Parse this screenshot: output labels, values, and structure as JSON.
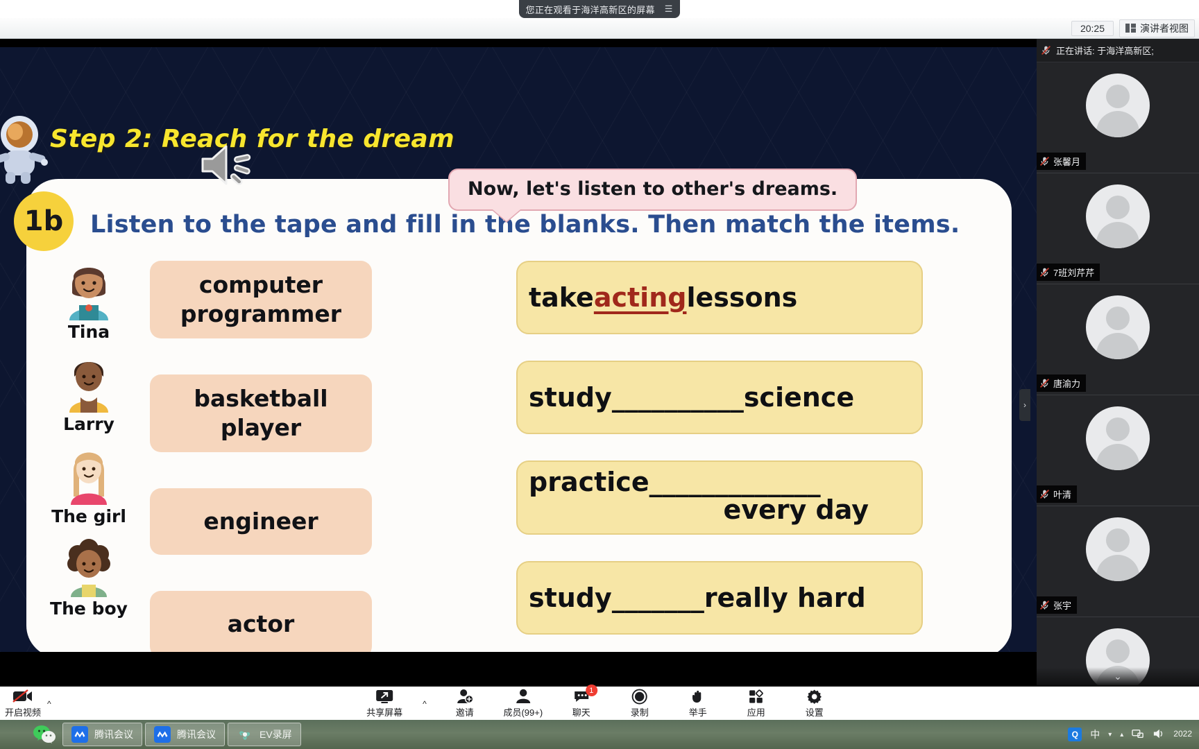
{
  "banner": {
    "text": "您正在观看于海洋高新区的屏幕",
    "menu_glyph": "☰"
  },
  "chrome": {
    "clock": "20:25",
    "speaker_view_label": "演讲者视图"
  },
  "slide": {
    "title": "Step 2: Reach for the dream",
    "badge": "1b",
    "instruction": "Listen to the tape and fill in the blanks. Then match the items.",
    "bubble": "Now, let's listen to other's dreams.",
    "characters": [
      {
        "name": "Tina",
        "avatar": "girl-brown-bob-avatar"
      },
      {
        "name": "Larry",
        "avatar": "boy-yellow-shirt-avatar"
      },
      {
        "name": "The girl",
        "avatar": "girl-long-blonde-avatar"
      },
      {
        "name": "The boy",
        "avatar": "boy-curly-hair-avatar"
      }
    ],
    "jobs": [
      "computer programmer",
      "basketball player",
      "engineer",
      "actor"
    ],
    "answers": [
      {
        "before": "take ",
        "fill": "acting",
        "after": " lessons",
        "blank": ""
      },
      {
        "before": "study",
        "fill": "",
        "after": " science",
        "blank": "__________"
      },
      {
        "before": "practice",
        "fill": "",
        "after": "every day",
        "blank": "_____________"
      },
      {
        "before": "study",
        "fill": "",
        "after": " really hard",
        "blank": "_______"
      }
    ]
  },
  "people": {
    "speaking_label": "正在讲话: 于海洋高新区;",
    "participants": [
      {
        "name": "张馨月",
        "muted": true
      },
      {
        "name": "7班刘芹芹",
        "muted": true
      },
      {
        "name": "唐渝力",
        "muted": true
      },
      {
        "name": "叶清",
        "muted": true
      },
      {
        "name": "张宇",
        "muted": true
      },
      {
        "name": "",
        "muted": false
      }
    ],
    "more_glyph": "⌄"
  },
  "toolbar": {
    "video_label": "开启视频",
    "items": [
      {
        "label": "共享屏幕",
        "icon": "share-screen-icon",
        "badge": ""
      },
      {
        "label": "邀请",
        "icon": "invite-icon",
        "badge": ""
      },
      {
        "label": "成员(99+)",
        "icon": "members-icon",
        "badge": ""
      },
      {
        "label": "聊天",
        "icon": "chat-icon",
        "badge": "1"
      },
      {
        "label": "录制",
        "icon": "record-icon",
        "badge": ""
      },
      {
        "label": "举手",
        "icon": "raise-hand-icon",
        "badge": ""
      },
      {
        "label": "应用",
        "icon": "apps-icon",
        "badge": ""
      },
      {
        "label": "设置",
        "icon": "settings-icon",
        "badge": ""
      }
    ]
  },
  "taskbar": {
    "apps": [
      {
        "label": "腾讯会议",
        "icon": "tencent-meeting-icon"
      },
      {
        "label": "腾讯会议",
        "icon": "tencent-meeting-icon"
      },
      {
        "label": "EV录屏",
        "icon": "ev-recorder-icon"
      }
    ],
    "tray": {
      "ime": "中",
      "date_line1": "2022"
    }
  },
  "colors": {
    "slide_bg": "#0d1630",
    "title_yellow": "#f8e62e",
    "instruction_blue": "#2a4d8f",
    "job_peach": "#f6d6bd",
    "answer_yellow": "#f7e6a6",
    "fill_red": "#a0281b",
    "bubble_pink": "#fadfe2",
    "badge_red": "#ef3d32"
  }
}
